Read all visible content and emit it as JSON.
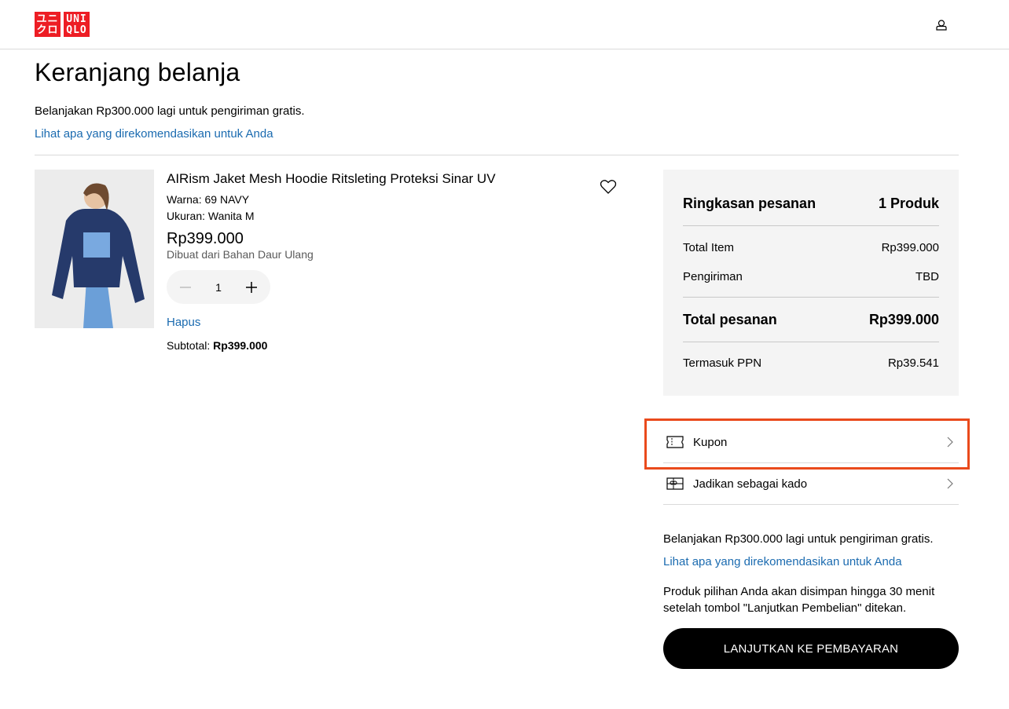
{
  "brand": {
    "logo_left_lines": [
      "ユニ",
      "クロ"
    ],
    "logo_right_lines": [
      "UNI",
      "QLO"
    ],
    "color": "#ed1d24"
  },
  "header": {
    "account_icon": "account-icon"
  },
  "cart": {
    "title": "Keranjang belanja",
    "free_shipping_msg": "Belanjakan Rp300.000 lagi untuk pengiriman gratis.",
    "recommend_link": "Lihat apa yang direkomendasikan untuk Anda"
  },
  "item": {
    "name": "AIRism Jaket Mesh Hoodie Ritsleting Proteksi Sinar UV",
    "color": "Warna: 69 NAVY",
    "size": "Ukuran: Wanita M",
    "price": "Rp399.000",
    "material": "Dibuat dari Bahan Daur Ulang",
    "quantity": "1",
    "remove_label": "Hapus",
    "subtotal_label": "Subtotal:",
    "subtotal_value": "Rp399.000"
  },
  "summary": {
    "title": "Ringkasan pesanan",
    "count": "1 Produk",
    "total_item_label": "Total Item",
    "total_item_value": "Rp399.000",
    "shipping_label": "Pengiriman",
    "shipping_value": "TBD",
    "total_label": "Total pesanan",
    "total_value": "Rp399.000",
    "vat_label": "Termasuk PPN",
    "vat_value": "Rp39.541"
  },
  "options": {
    "coupon_label": "Kupon",
    "gift_label": "Jadikan sebagai kado"
  },
  "footer": {
    "free_shipping_msg": "Belanjakan Rp300.000 lagi untuk pengiriman gratis.",
    "recommend_link": "Lihat apa yang direkomendasikan untuk Anda",
    "reserve_note": "Produk pilihan Anda akan disimpan hingga 30 menit setelah tombol \"Lanjutkan Pembelian\" ditekan.",
    "checkout_label": "LANJUTKAN KE PEMBAYARAN"
  },
  "colors": {
    "link": "#1b6bb0",
    "highlight": "#ea4a1c"
  }
}
